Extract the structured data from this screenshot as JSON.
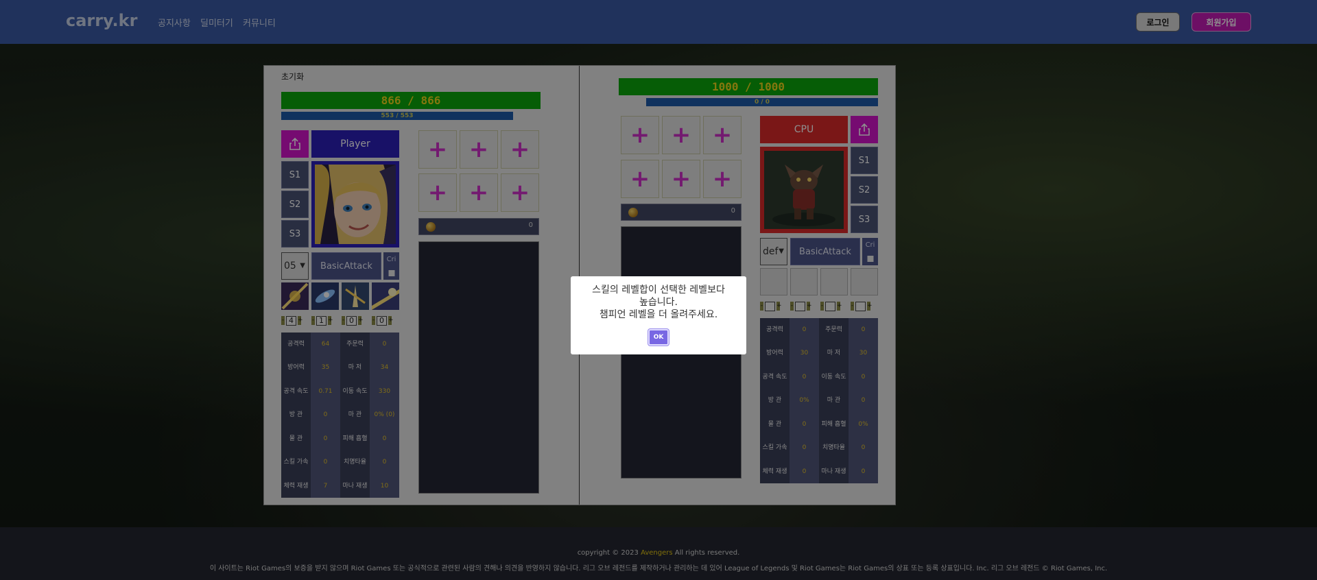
{
  "header": {
    "logo": "carry.kr",
    "nav": [
      "공지사항",
      "딜미터기",
      "커뮤니티"
    ],
    "login_label": "로그인",
    "signup_label": "회원가입"
  },
  "simulator": {
    "reset_label": "초기화",
    "player": {
      "hp": "866 / 866",
      "mp": "553 / 553",
      "name": "Player",
      "summoner_buttons": [
        "S1",
        "S2",
        "S3"
      ],
      "level": "05",
      "basic_attack_label": "BasicAttack",
      "cri_label": "Cri",
      "skill_levels": [
        "4",
        "1",
        "0",
        "0"
      ],
      "gold": "0",
      "stats": [
        {
          "label": "공격력",
          "value": "64",
          "label2": "주문력",
          "value2": "0"
        },
        {
          "label": "방어력",
          "value": "35",
          "label2": "마 저",
          "value2": "34"
        },
        {
          "label": "공격 속도",
          "value": "0.71",
          "label2": "이동 속도",
          "value2": "330"
        },
        {
          "label": "방 관",
          "value": "0",
          "label2": "마 관",
          "value2": "0% (0)"
        },
        {
          "label": "물 관",
          "value": "0",
          "label2": "피해 흡혈",
          "value2": "0"
        },
        {
          "label": "스킬 가속",
          "value": "0",
          "label2": "치명타율",
          "value2": "0"
        },
        {
          "label": "체력 재생",
          "value": "7",
          "label2": "마나 재생",
          "value2": "10"
        }
      ]
    },
    "cpu": {
      "hp": "1000 / 1000",
      "mp": "0 / 0",
      "name": "CPU",
      "summoner_buttons": [
        "S1",
        "S2",
        "S3"
      ],
      "level": "def",
      "basic_attack_label": "BasicAttack",
      "cri_label": "Cri",
      "gold": "0",
      "stats": [
        {
          "label": "공격력",
          "value": "0",
          "label2": "주문력",
          "value2": "0"
        },
        {
          "label": "방어력",
          "value": "30",
          "label2": "마 저",
          "value2": "30"
        },
        {
          "label": "공격 속도",
          "value": "0",
          "label2": "이동 속도",
          "value2": "0"
        },
        {
          "label": "방 관",
          "value": "0%",
          "label2": "마 관",
          "value2": "0"
        },
        {
          "label": "물 관",
          "value": "0",
          "label2": "피해 흡혈",
          "value2": "0%"
        },
        {
          "label": "스킬 가속",
          "value": "0",
          "label2": "치명타율",
          "value2": "0"
        },
        {
          "label": "체력 재생",
          "value": "0",
          "label2": "마나 재생",
          "value2": "0"
        }
      ]
    }
  },
  "modal": {
    "message": "스킬의 레벨합이 선택한 레벨보다\n높습니다.\n챔피언 레벨을 더 올려주세요.",
    "ok_label": "OK"
  },
  "footer": {
    "copyright_prefix": "copyright © 2023",
    "brand": "Avengers",
    "copyright_suffix": "All rights reserved.",
    "disclaimer": "이 사이트는 Riot Games의 보증을 받지 않으며 Riot Games 또는 공식적으로 관련된 사람의 견해나 의견을 반영하지 않습니다. 리그 오브 레전드를 제작하거나 관리하는 데 있어 League of Legends 및 Riot Games는 Riot Games의 상표 또는 등록 상표입니다. Inc. 리그 오브 레전드 © Riot Games, Inc."
  },
  "colors": {
    "header_bg": "#3a5aa5",
    "hp_green": "#0ca70c",
    "mp_blue": "#1e5aa8",
    "player_name_bg": "#2c1fb8",
    "cpu_name_bg": "#d92a2a",
    "share_magenta": "#d214c9",
    "item_plus": "#ce2fc8",
    "stat_value": "#e5c12a",
    "ok_button": "#7867e3",
    "footer_brand": "#e3c414"
  }
}
